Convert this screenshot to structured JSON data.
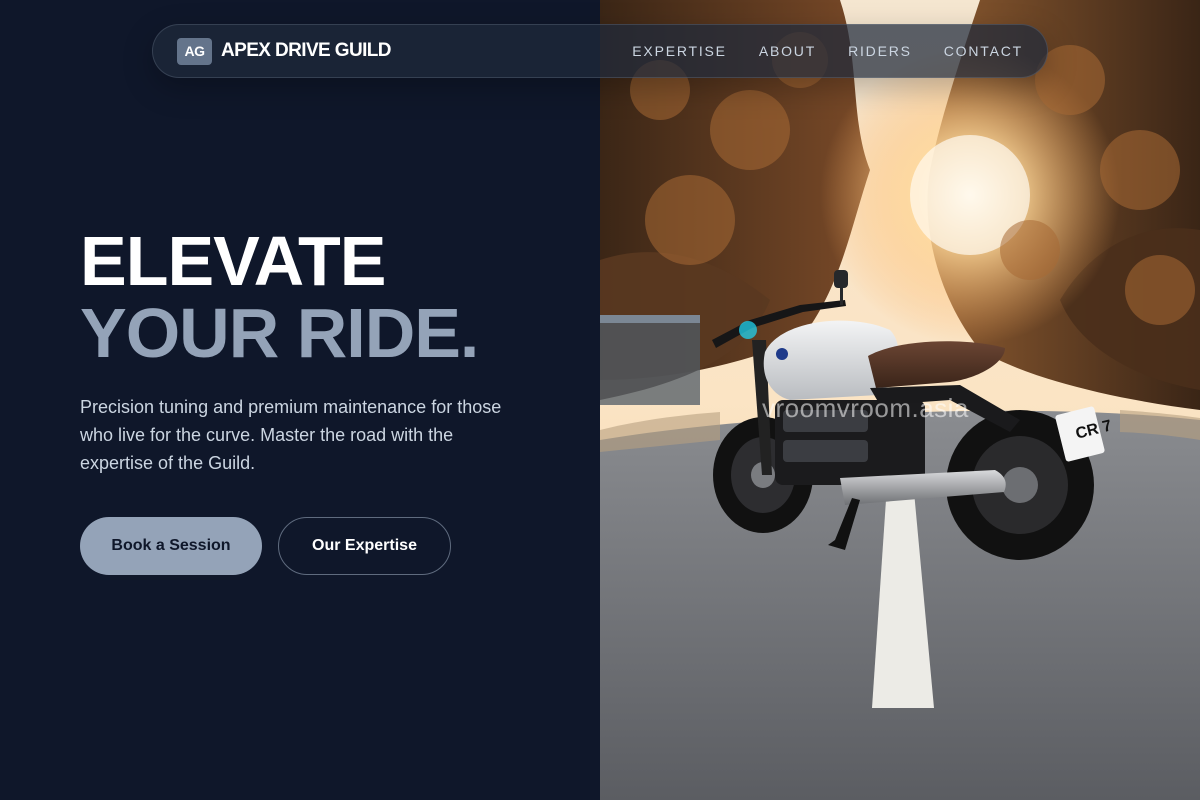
{
  "brand": {
    "badge": "AG",
    "name": "APEX DRIVE GUILD"
  },
  "nav": {
    "links": [
      "EXPERTISE",
      "ABOUT",
      "RIDERS",
      "CONTACT"
    ]
  },
  "hero": {
    "title_line1": "ELEVATE",
    "title_line2": "YOUR RIDE.",
    "description": "Precision tuning and premium maintenance for those who live for the curve. Master the road with the expertise of the Guild.",
    "primary_button": "Book a Session",
    "secondary_button": "Our Expertise"
  },
  "image": {
    "watermark": "vroomvroom.asia",
    "plate": "CR 7"
  },
  "colors": {
    "background": "#0f172a",
    "accent": "#94a3b8",
    "badge": "#64748b"
  }
}
